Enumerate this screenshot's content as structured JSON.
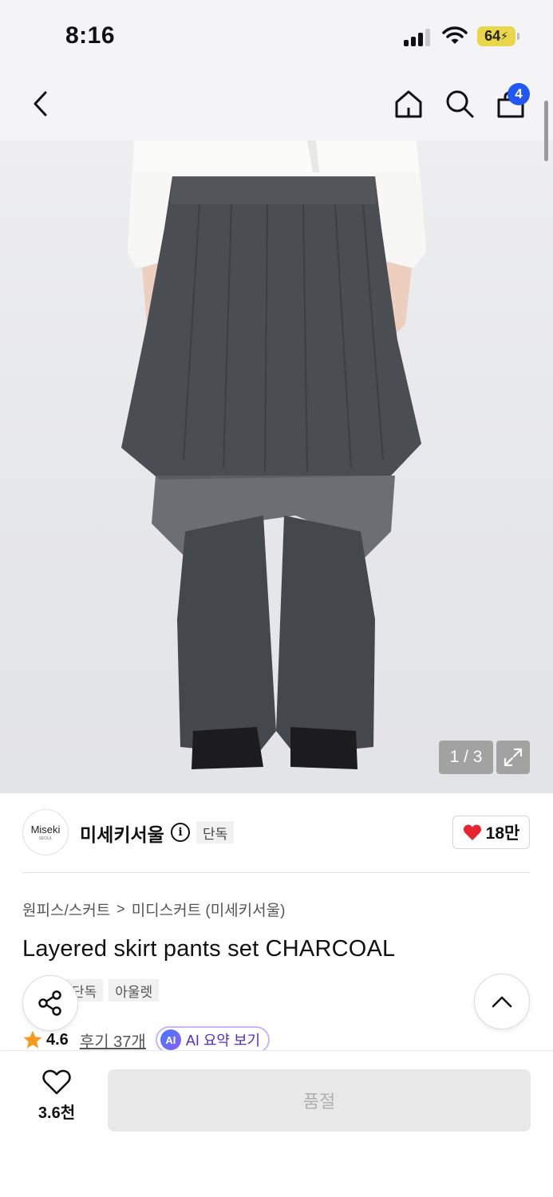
{
  "status_bar": {
    "time": "8:16",
    "battery": "64"
  },
  "nav": {
    "cart_count": "4"
  },
  "image": {
    "counter": "1 / 3"
  },
  "brand": {
    "logo_line1": "Miseki",
    "logo_line2": "SEOUL",
    "name": "미세키서울",
    "info_icon": "i",
    "badge": "단독",
    "like_count": "18만"
  },
  "breadcrumb": {
    "level1": "원피스/스커트",
    "separator": ">",
    "level2": "미디스커트 (미세키서울)"
  },
  "product": {
    "title": "Layered skirt pants set CHARCOAL",
    "tags": [
      "단독",
      "아울렛"
    ]
  },
  "rating": {
    "value": "4.6",
    "reviews_label": "후기 37개",
    "ai_badge": "AI",
    "ai_summary_label": "AI 요약 보기"
  },
  "bottom_bar": {
    "wish_count": "3.6천",
    "buy_button_label": "품절"
  },
  "colors": {
    "accent_blue": "#2357f5",
    "heart_red": "#e5262f",
    "star_orange": "#f59a1b",
    "ai_purple": "#4f2fd0"
  }
}
